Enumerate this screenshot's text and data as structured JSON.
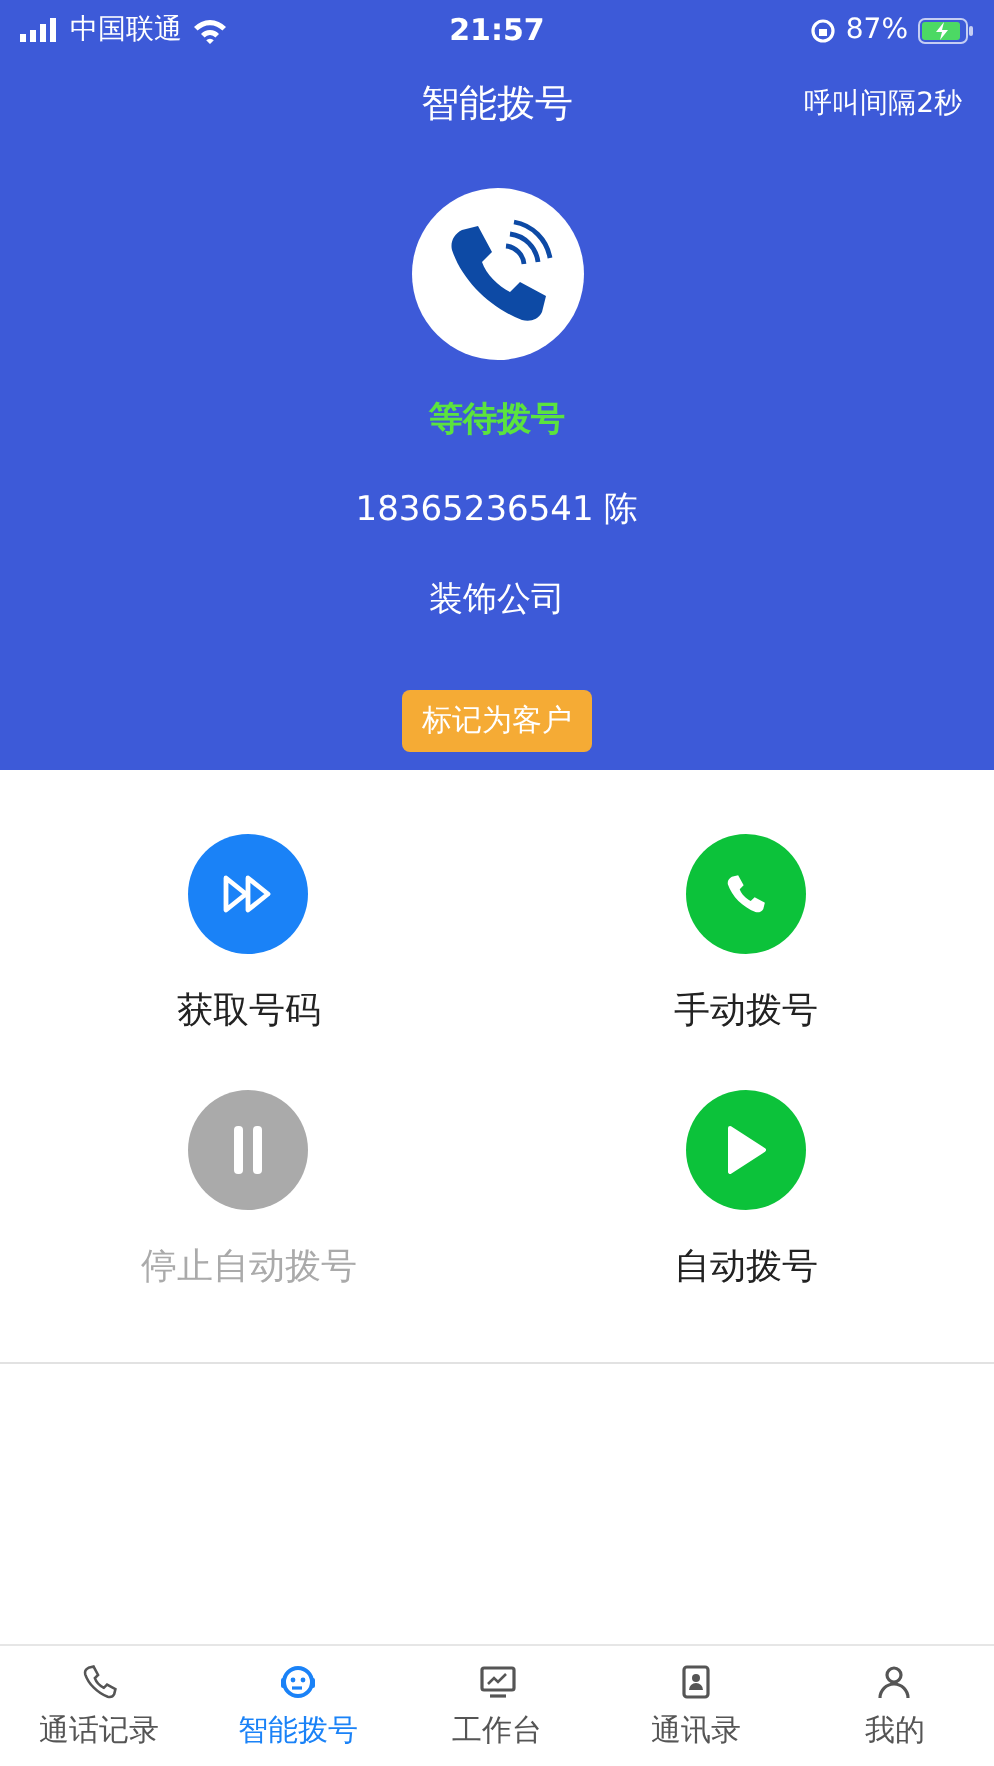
{
  "status_bar": {
    "carrier": "中国联通",
    "time": "21:57",
    "battery": "87%"
  },
  "header": {
    "title": "智能拨号",
    "interval": "呼叫间隔2秒"
  },
  "call": {
    "status": "等待拨号",
    "number": "18365236541 陈",
    "company": "装饰公司",
    "mark_button": "标记为客户"
  },
  "actions": [
    {
      "kind": "forward",
      "label": "获取号码",
      "color": "#1a82f7",
      "disabled": false
    },
    {
      "kind": "phone",
      "label": "手动拨号",
      "color": "#0cc23a",
      "disabled": false
    },
    {
      "kind": "pause",
      "label": "停止自动拨号",
      "color": "#aaaaaa",
      "disabled": true
    },
    {
      "kind": "play",
      "label": "自动拨号",
      "color": "#0cc23a",
      "disabled": false
    }
  ],
  "tabs": [
    {
      "kind": "phone",
      "label": "通话记录",
      "selected": false
    },
    {
      "kind": "robot",
      "label": "智能拨号",
      "selected": true
    },
    {
      "kind": "monitor",
      "label": "工作台",
      "selected": false
    },
    {
      "kind": "contacts",
      "label": "通讯录",
      "selected": false
    },
    {
      "kind": "person",
      "label": "我的",
      "selected": false
    }
  ]
}
